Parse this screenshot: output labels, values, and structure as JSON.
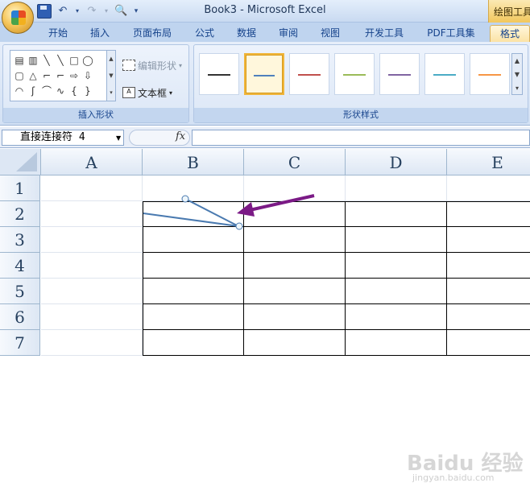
{
  "window": {
    "title": "Book3 - Microsoft Excel",
    "contextual_tab": "绘图工具"
  },
  "tabs": [
    {
      "label": "开始"
    },
    {
      "label": "插入"
    },
    {
      "label": "页面布局"
    },
    {
      "label": "公式"
    },
    {
      "label": "数据"
    },
    {
      "label": "审阅"
    },
    {
      "label": "视图"
    },
    {
      "label": "开发工具"
    },
    {
      "label": "PDF工具集"
    },
    {
      "label": "格式",
      "active": true
    }
  ],
  "ribbon": {
    "insert_shapes": {
      "label": "插入形状",
      "edit_shape": "编辑形状",
      "text_box": "文本框",
      "shape_icons": [
        "▤",
        "▥",
        "╲",
        "╲",
        "□",
        "◯",
        "",
        "▢",
        "△",
        "⌐",
        "⌐",
        "⇨",
        "⇩",
        "",
        "◠",
        "ʃ",
        "⌒",
        "∿",
        "{",
        "}",
        ""
      ]
    },
    "shape_styles": {
      "label": "形状样式",
      "colors": [
        "#333333",
        "#4f81bd",
        "#c0504d",
        "#9bbb59",
        "#8064a2",
        "#4bacc6",
        "#f79646"
      ],
      "selected_index": 1
    }
  },
  "formula_bar": {
    "name_box": "直接连接符 4",
    "fx": "fx",
    "formula": ""
  },
  "sheet": {
    "columns": [
      "A",
      "B",
      "C",
      "D",
      "E"
    ],
    "rows": [
      "1",
      "2",
      "3",
      "4",
      "5",
      "6",
      "7"
    ]
  },
  "overlay": {
    "connector_color": "#4a7ab0",
    "arrow_color": "#7b1a86",
    "watermark": "Baidu 经验",
    "watermark_sub": "jingyan.baidu.com"
  }
}
